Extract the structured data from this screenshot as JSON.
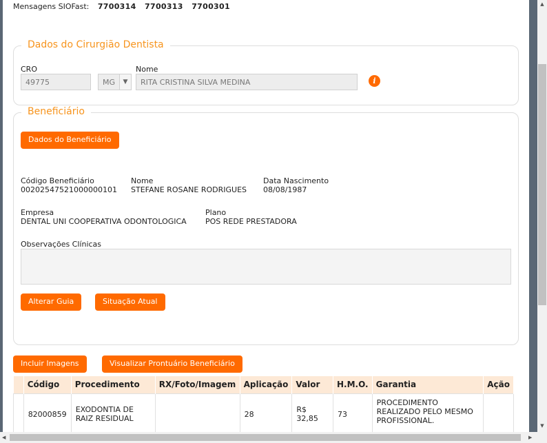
{
  "header": {
    "messages_label": "Mensagens SIOFast:",
    "message_codes": [
      "7700314",
      "7700313",
      "7700301"
    ]
  },
  "dentist": {
    "legend": "Dados do Cirurgião Dentista",
    "cro_label": "CRO",
    "cro_value": "49775",
    "uf_value": "MG",
    "name_label": "Nome",
    "name_value": "RITA CRISTINA SILVA MEDINA",
    "info_glyph": "i"
  },
  "beneficiary": {
    "legend": "Beneficiário",
    "details_button": "Dados do Beneficiário",
    "code_label": "Código Beneficiário",
    "code_value": "00202547521000000101",
    "name_label": "Nome",
    "name_value": "STEFANE ROSANE RODRIGUES",
    "birth_label": "Data Nascimento",
    "birth_value": "08/08/1987",
    "company_label": "Empresa",
    "company_value": "DENTAL UNI COOPERATIVA ODONTOLOGICA",
    "plan_label": "Plano",
    "plan_value": "POS REDE PRESTADORA",
    "obs_label": "Observações Clínicas",
    "alter_button": "Alterar Guia",
    "status_button": "Situação Atual"
  },
  "actions": {
    "include_images": "Incluir Imagens",
    "view_record": "Visualizar Prontuário Beneficiário"
  },
  "table": {
    "headers": [
      "",
      "Código",
      "Procedimento",
      "RX/Foto/Imagem",
      "Aplicação",
      "Valor",
      "H.M.O.",
      "Garantia",
      "Ação"
    ],
    "rows": [
      {
        "code": "82000859",
        "procedure": "EXODONTIA DE RAIZ RESIDUAL",
        "rx": "",
        "application": "28",
        "value": "R$ 32,85",
        "hmo": "73",
        "guarantee": "PROCEDIMENTO REALIZADO PELO MESMO PROFISSIONAL.",
        "action": ""
      }
    ]
  },
  "icons": {
    "scroll_up": "scroll-up-arrow-icon",
    "scroll_down": "scroll-down-arrow-icon",
    "info": "info-icon"
  },
  "colors": {
    "accent": "#ff6a00",
    "legend": "#f7941d",
    "table_header": "#fde9d6",
    "sidebar": "#5a6775"
  }
}
